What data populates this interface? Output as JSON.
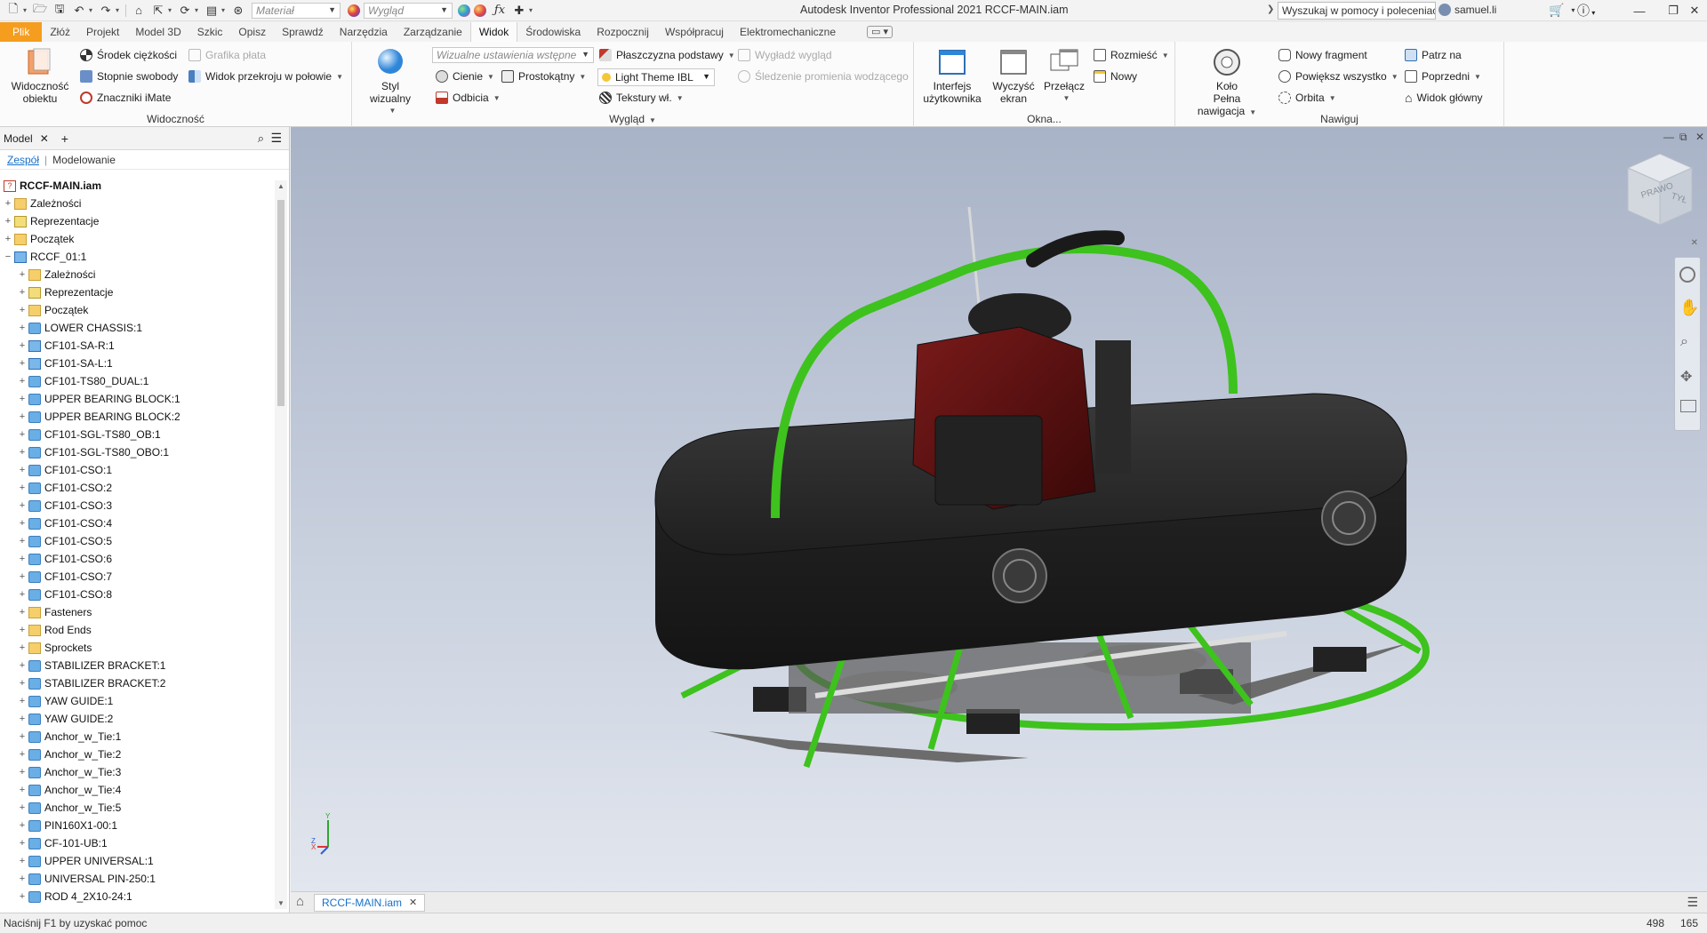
{
  "titlebar": {
    "app_title": "Autodesk Inventor Professional 2021   RCCF-MAIN.iam",
    "material_placeholder": "Materiał",
    "appearance_placeholder": "Wygląd",
    "search_text": "Wyszukaj w pomocy i poleceniach",
    "username": "samuel.li"
  },
  "tabs": [
    "Plik",
    "Złóż",
    "Projekt",
    "Model 3D",
    "Szkic",
    "Opisz",
    "Sprawdź",
    "Narzędzia",
    "Zarządzanie",
    "Widok",
    "Środowiska",
    "Rozpocznij",
    "Współpracuj",
    "Elektromechaniczne"
  ],
  "ribbon": {
    "visibility": {
      "label": "Widoczność",
      "object_visibility_line1": "Widoczność",
      "object_visibility_line2": "obiektu",
      "center_of_gravity": "Środek ciężkości",
      "dof": "Stopnie swobody",
      "imate_glyphs": "Znaczniki iMate",
      "plate_graphics": "Grafika płata",
      "half_section": "Widok przekroju w połowie"
    },
    "appearance": {
      "label": "Wygląd",
      "visual_style_line1": "Styl wizualny",
      "visual_settings_placeholder": "Wizualne ustawienia wstępne",
      "shadows": "Cienie",
      "reflections": "Odbicia",
      "orthographic": "Prostokątny",
      "ground_plane": "Płaszczyzna podstawy",
      "ibl_theme": "Light Theme IBL",
      "textures": "Tekstury wł.",
      "smooth_appearance": "Wygładź wygląd",
      "ray_tracing": "Śledzenie promienia wodzącego"
    },
    "windows": {
      "label": "Okna...",
      "ui_line1": "Interfejs",
      "ui_line2": "użytkownika",
      "clean_line1": "Wyczyść",
      "clean_line2": "ekran",
      "switch": "Przełącz",
      "arrange": "Rozmieść",
      "new": "Nowy"
    },
    "navigate": {
      "label": "Nawiguj",
      "wheel_line1": "Koło",
      "wheel_line2": "Pełna nawigacja",
      "new_fragment": "Nowy fragment",
      "zoom_all": "Powiększ wszystko",
      "orbit": "Orbita",
      "look_at": "Patrz na",
      "previous": "Poprzedni",
      "home_view": "Widok główny"
    }
  },
  "browser": {
    "title": "Model",
    "subtabs": [
      "Zespół",
      "Modelowanie"
    ],
    "root": "RCCF-MAIN.iam",
    "items": [
      {
        "label": "Zależności",
        "indent": 0,
        "icon": "folder",
        "exp": "+"
      },
      {
        "label": "Reprezentacje",
        "indent": 0,
        "icon": "rep",
        "exp": "+"
      },
      {
        "label": "Początek",
        "indent": 0,
        "icon": "folder",
        "exp": "+"
      },
      {
        "label": "RCCF_01:1",
        "indent": 0,
        "icon": "asm",
        "exp": "−"
      },
      {
        "label": "Zależności",
        "indent": 1,
        "icon": "folder",
        "exp": "+"
      },
      {
        "label": "Reprezentacje",
        "indent": 1,
        "icon": "rep",
        "exp": "+"
      },
      {
        "label": "Początek",
        "indent": 1,
        "icon": "folder",
        "exp": "+"
      },
      {
        "label": "LOWER CHASSIS:1",
        "indent": 1,
        "icon": "part",
        "exp": "+"
      },
      {
        "label": "CF101-SA-R:1",
        "indent": 1,
        "icon": "asm",
        "exp": "+"
      },
      {
        "label": "CF101-SA-L:1",
        "indent": 1,
        "icon": "asm",
        "exp": "+"
      },
      {
        "label": "CF101-TS80_DUAL:1",
        "indent": 1,
        "icon": "part",
        "exp": "+"
      },
      {
        "label": "UPPER BEARING BLOCK:1",
        "indent": 1,
        "icon": "part",
        "exp": "+"
      },
      {
        "label": "UPPER BEARING BLOCK:2",
        "indent": 1,
        "icon": "part",
        "exp": "+"
      },
      {
        "label": "CF101-SGL-TS80_OB:1",
        "indent": 1,
        "icon": "part",
        "exp": "+"
      },
      {
        "label": "CF101-SGL-TS80_OBO:1",
        "indent": 1,
        "icon": "part",
        "exp": "+"
      },
      {
        "label": "CF101-CSO:1",
        "indent": 1,
        "icon": "part",
        "exp": "+"
      },
      {
        "label": "CF101-CSO:2",
        "indent": 1,
        "icon": "part",
        "exp": "+"
      },
      {
        "label": "CF101-CSO:3",
        "indent": 1,
        "icon": "part",
        "exp": "+"
      },
      {
        "label": "CF101-CSO:4",
        "indent": 1,
        "icon": "part",
        "exp": "+"
      },
      {
        "label": "CF101-CSO:5",
        "indent": 1,
        "icon": "part",
        "exp": "+"
      },
      {
        "label": "CF101-CSO:6",
        "indent": 1,
        "icon": "part",
        "exp": "+"
      },
      {
        "label": "CF101-CSO:7",
        "indent": 1,
        "icon": "part",
        "exp": "+"
      },
      {
        "label": "CF101-CSO:8",
        "indent": 1,
        "icon": "part",
        "exp": "+"
      },
      {
        "label": "Fasteners",
        "indent": 1,
        "icon": "folder",
        "exp": "+"
      },
      {
        "label": "Rod Ends",
        "indent": 1,
        "icon": "folder",
        "exp": "+"
      },
      {
        "label": "Sprockets",
        "indent": 1,
        "icon": "folder",
        "exp": "+"
      },
      {
        "label": "STABILIZER BRACKET:1",
        "indent": 1,
        "icon": "part",
        "exp": "+"
      },
      {
        "label": "STABILIZER BRACKET:2",
        "indent": 1,
        "icon": "part",
        "exp": "+"
      },
      {
        "label": "YAW GUIDE:1",
        "indent": 1,
        "icon": "part",
        "exp": "+"
      },
      {
        "label": "YAW GUIDE:2",
        "indent": 1,
        "icon": "part",
        "exp": "+"
      },
      {
        "label": "Anchor_w_Tie:1",
        "indent": 1,
        "icon": "part",
        "exp": "+"
      },
      {
        "label": "Anchor_w_Tie:2",
        "indent": 1,
        "icon": "part",
        "exp": "+"
      },
      {
        "label": "Anchor_w_Tie:3",
        "indent": 1,
        "icon": "part",
        "exp": "+"
      },
      {
        "label": "Anchor_w_Tie:4",
        "indent": 1,
        "icon": "part",
        "exp": "+"
      },
      {
        "label": "Anchor_w_Tie:5",
        "indent": 1,
        "icon": "part",
        "exp": "+"
      },
      {
        "label": "PIN160X1-00:1",
        "indent": 1,
        "icon": "part",
        "exp": "+"
      },
      {
        "label": "CF-101-UB:1",
        "indent": 1,
        "icon": "part",
        "exp": "+"
      },
      {
        "label": "UPPER UNIVERSAL:1",
        "indent": 1,
        "icon": "part",
        "exp": "+"
      },
      {
        "label": "UNIVERSAL PIN-250:1",
        "indent": 1,
        "icon": "part",
        "exp": "+"
      },
      {
        "label": "ROD 4_2X10-24:1",
        "indent": 1,
        "icon": "part",
        "exp": "+"
      }
    ]
  },
  "viewcube": {
    "left_face": "PRAWO",
    "front_face": "TYŁ"
  },
  "triad": {
    "x": "X",
    "y": "Y",
    "z": "Z"
  },
  "doctab": {
    "label": "RCCF-MAIN.iam"
  },
  "statusbar": {
    "help_text": "Naciśnij F1 by uzyskać pomoc",
    "count1": "498",
    "count2": "165"
  },
  "colors": {
    "file_tab": "#f59d1f",
    "accent_blue": "#1670c8",
    "frame_green": "#3ec21e"
  }
}
